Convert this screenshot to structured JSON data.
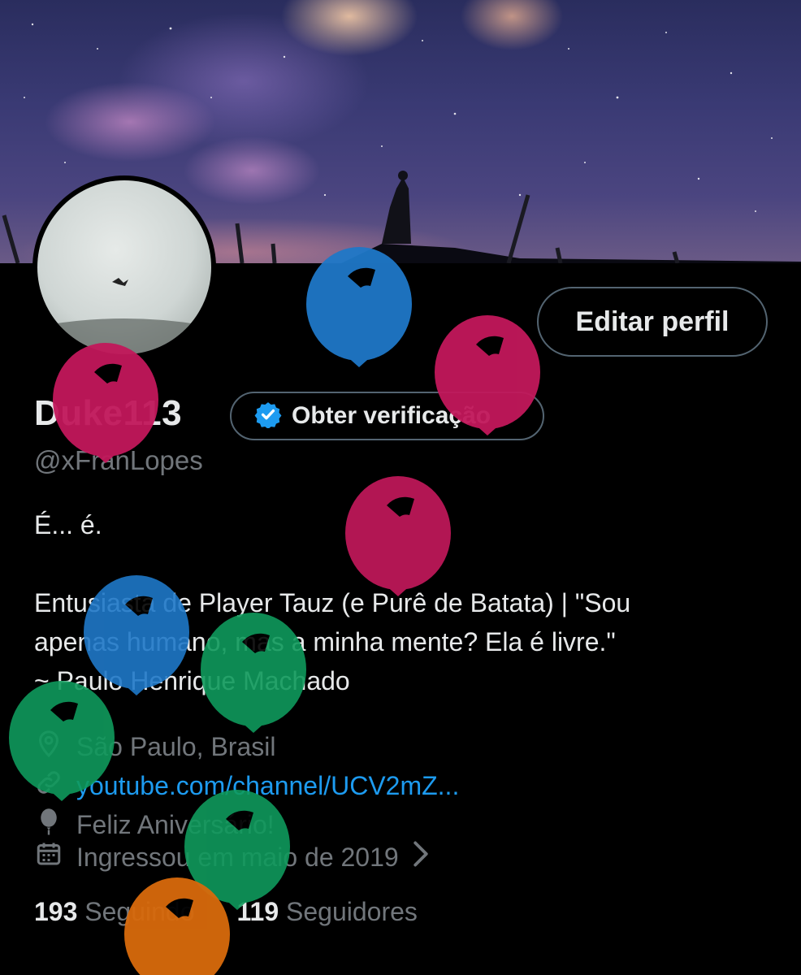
{
  "profile": {
    "display_name": "Duke113",
    "handle": "@xFranLopes",
    "edit_label": "Editar perfil",
    "verify_label": "Obter verificação",
    "bio_line1": "É... é.",
    "bio_line2": "Entusiasta de Player Tauz (e Purê de Batata) | \"Sou",
    "bio_line3": "apenas humano, mas a minha mente? Ela é livre.\"",
    "bio_line4": "~ Paulo Henrique Machado",
    "location": "São Paulo, Brasil",
    "website": "youtube.com/channel/UCV2mZ...",
    "birthday": "Feliz Aniversário!",
    "joined": "Ingressou em maio de 2019",
    "following_count": "193",
    "following_label": "Seguindo",
    "followers_count": "119",
    "followers_label": "Seguidores"
  },
  "icons": {
    "verified": "verified-badge-icon",
    "location": "location-pin-icon",
    "link": "link-icon",
    "birthday": "balloon-icon",
    "calendar": "calendar-icon",
    "chevron": "chevron-right-icon"
  },
  "colors": {
    "accent": "#1d9bf0",
    "muted": "#71767b",
    "balloon_pink": "#c2185b",
    "balloon_blue": "#1f78c8",
    "balloon_green": "#0f9a5c",
    "balloon_orange": "#d86a0c"
  }
}
